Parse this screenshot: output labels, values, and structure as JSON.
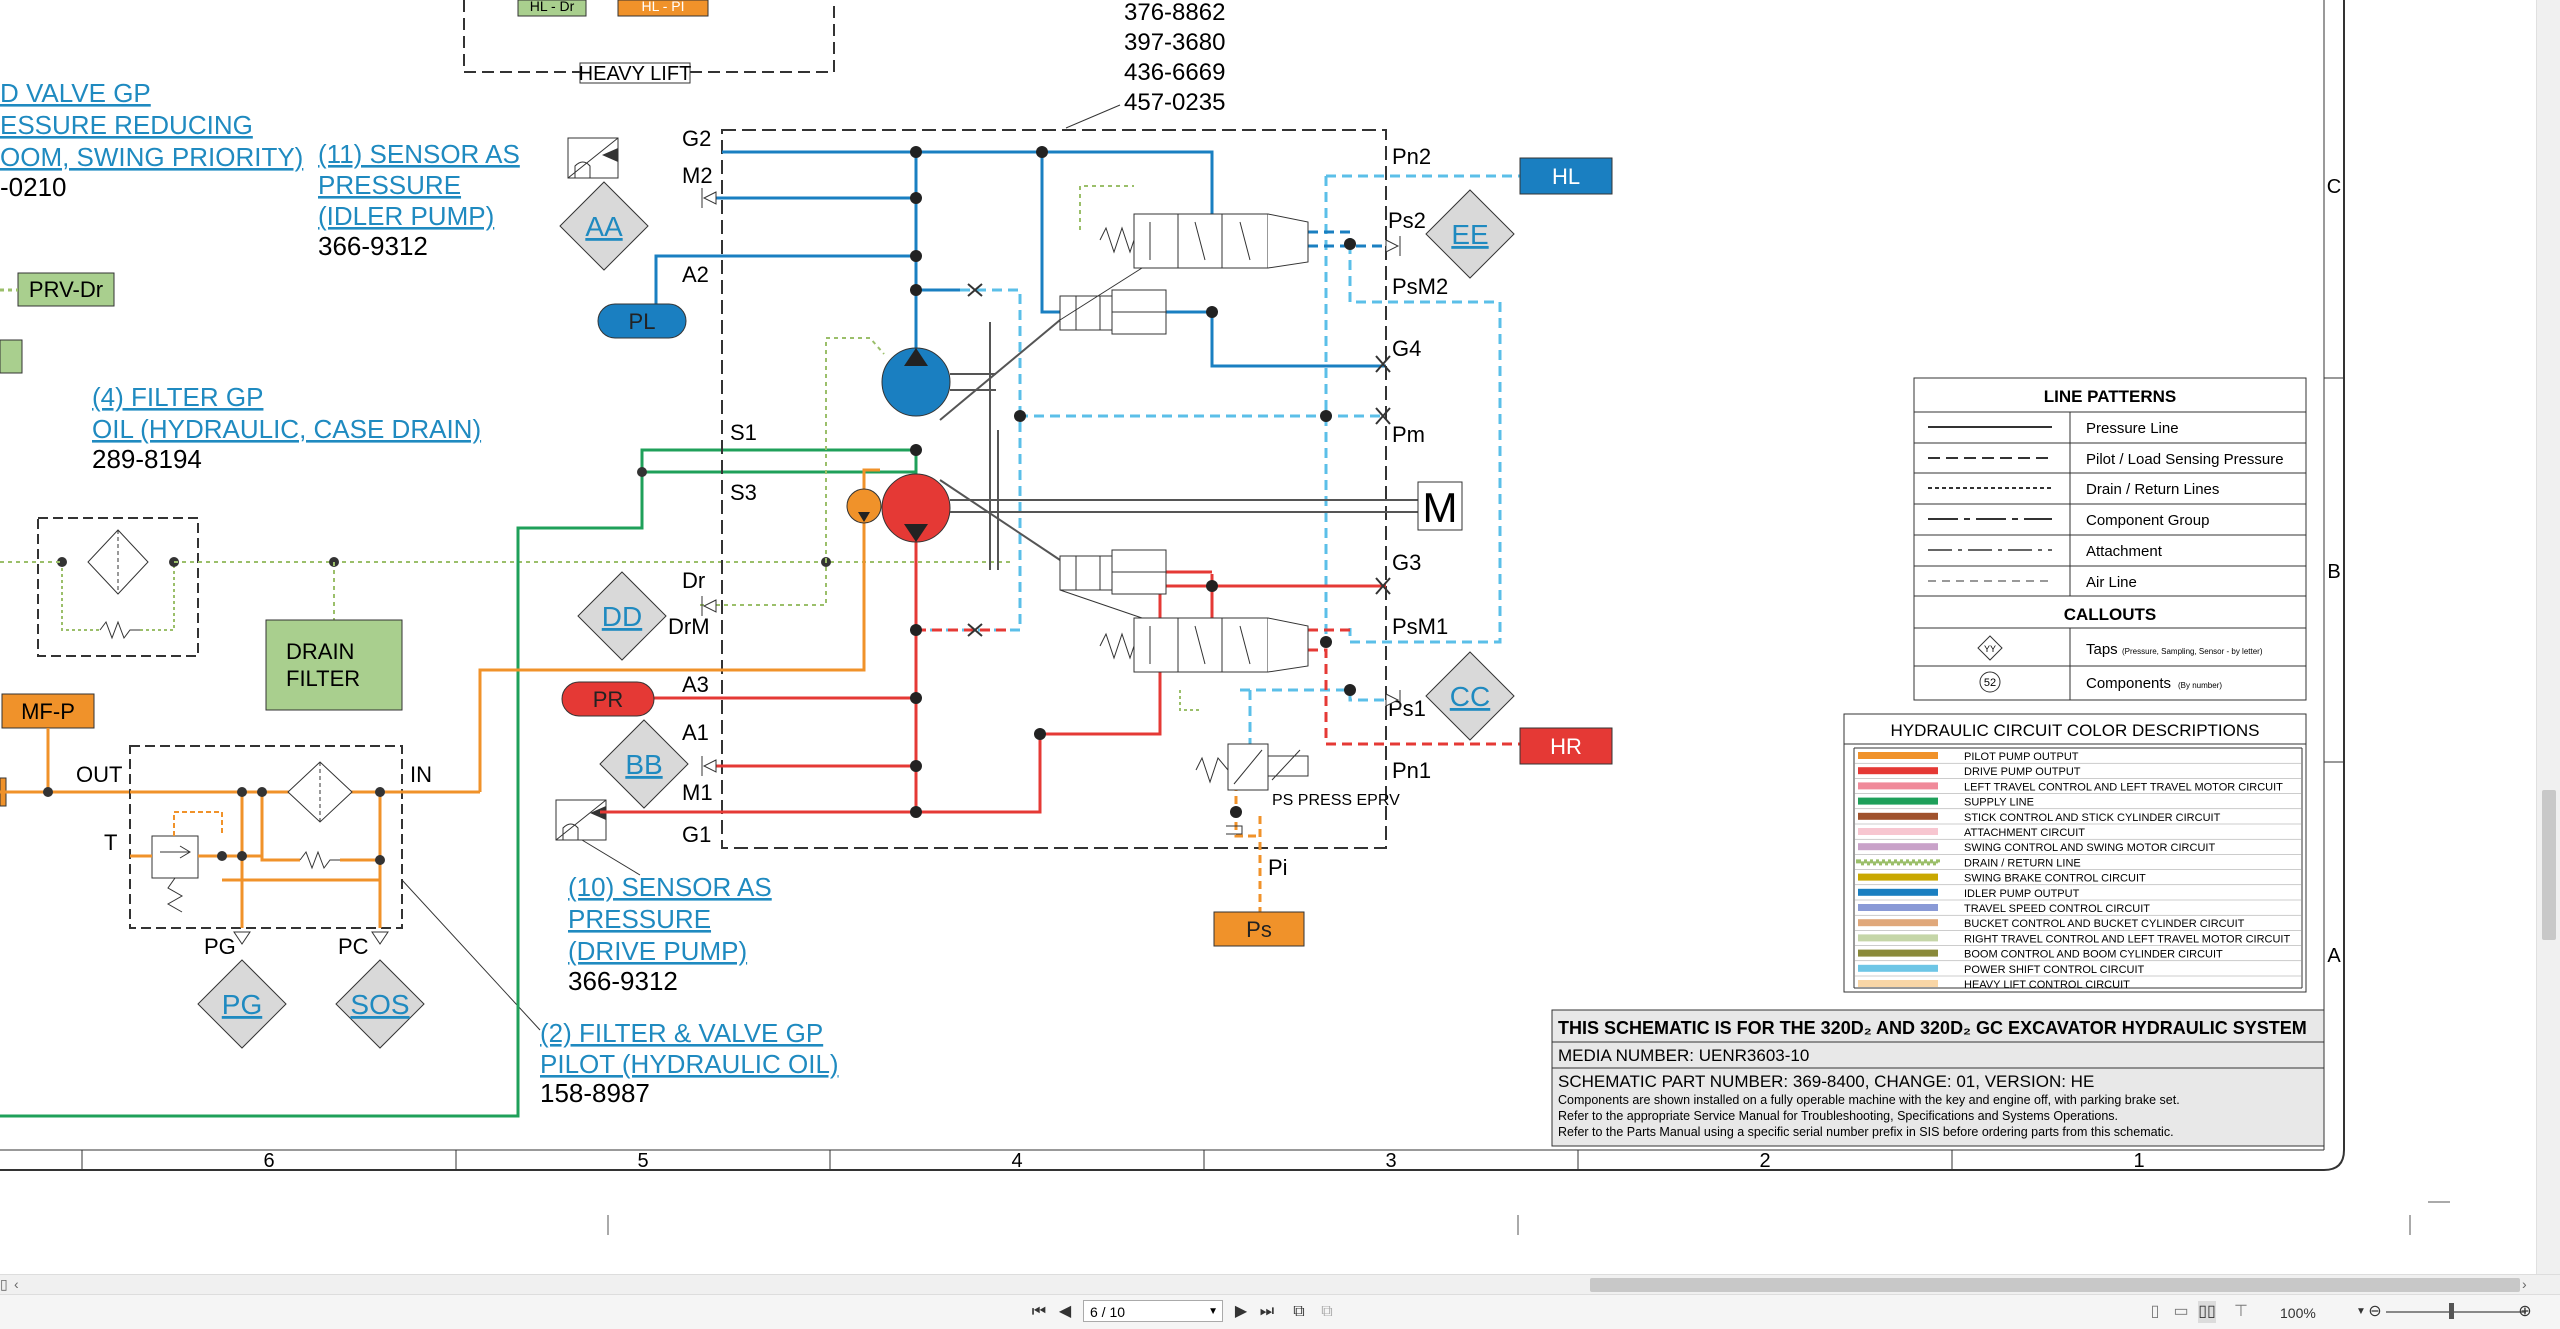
{
  "schematic": {
    "title_block": {
      "heading": "THIS SCHEMATIC IS FOR THE 320D₂ AND 320D₂ GC EXCAVATOR HYDRAULIC SYSTEM",
      "media": "MEDIA NUMBER: UENR3603-10",
      "part": "SCHEMATIC PART NUMBER: 369-8400, CHANGE: 01, VERSION: HE",
      "note1": "Components are shown installed on a fully operable machine with the key and engine off, with parking brake set.",
      "note2": "Refer to the appropriate Service Manual for Troubleshooting, Specifications and Systems Operations.",
      "note3": "Refer to the Parts Manual using a specific serial number prefix in SIS before ordering parts from this schematic."
    },
    "line_patterns": {
      "title": "LINE PATTERNS",
      "items": [
        "Pressure Line",
        "Pilot / Load Sensing Pressure",
        "Drain / Return Lines",
        "Component Group",
        "Attachment",
        "Air Line"
      ],
      "callouts_title": "CALLOUTS",
      "taps_label": "Taps",
      "taps_sub": "(Pressure, Sampling, Sensor - by letter)",
      "taps_symbol": "YY",
      "components_label": "Components",
      "components_sub": "(By number)",
      "components_symbol": "52"
    },
    "color_desc": {
      "title": "HYDRAULIC CIRCUIT COLOR DESCRIPTIONS",
      "items": [
        {
          "label": "PILOT PUMP OUTPUT",
          "color": "#f0922a"
        },
        {
          "label": "DRIVE PUMP OUTPUT",
          "color": "#e53935"
        },
        {
          "label": "LEFT TRAVEL CONTROL AND LEFT TRAVEL MOTOR CIRCUIT",
          "color": "#f08a9a"
        },
        {
          "label": "SUPPLY LINE",
          "color": "#1fa05a"
        },
        {
          "label": "STICK CONTROL AND STICK CYLINDER CIRCUIT",
          "color": "#a0522d"
        },
        {
          "label": "ATTACHMENT CIRCUIT",
          "color": "#f7c6d0"
        },
        {
          "label": "SWING CONTROL AND SWING MOTOR CIRCUIT",
          "color": "#c9a2c9"
        },
        {
          "label": "DRAIN / RETURN LINE",
          "color": "#9bbf6a"
        },
        {
          "label": "SWING BRAKE CONTROL CIRCUIT",
          "color": "#c9a800"
        },
        {
          "label": "IDLER PUMP OUTPUT",
          "color": "#1a7fc1"
        },
        {
          "label": "TRAVEL SPEED CONTROL CIRCUIT",
          "color": "#8a9ad6"
        },
        {
          "label": "BUCKET CONTROL AND BUCKET CYLINDER CIRCUIT",
          "color": "#e0a87a"
        },
        {
          "label": "RIGHT TRAVEL CONTROL AND LEFT TRAVEL MOTOR CIRCUIT",
          "color": "#c5d6a8"
        },
        {
          "label": "BOOM CONTROL AND BOOM CYLINDER CIRCUIT",
          "color": "#8a8a3a"
        },
        {
          "label": "POWER SHIFT CONTROL CIRCUIT",
          "color": "#6ec6e6"
        },
        {
          "label": "HEAVY LIFT CONTROL CIRCUIT",
          "color": "#f9d6a6"
        }
      ]
    },
    "grid": {
      "cols": [
        "6",
        "5",
        "4",
        "3",
        "2",
        "1"
      ],
      "rows": [
        "C",
        "B",
        "A"
      ]
    },
    "labels": {
      "heavy_lift": "HEAVY LIFT",
      "hl_dr": "HL - Dr",
      "hl_pi": "HL - PI",
      "pump_parts": [
        "376-8862",
        "397-3680",
        "436-6669",
        "457-0235"
      ],
      "valve_gp_1": "D VALVE GP",
      "valve_gp_2": "ESSURE REDUCING",
      "valve_gp_3": "OOM, SWING PRIORITY)",
      "valve_gp_4": "-0210",
      "sensor11_1": "(11) SENSOR AS",
      "sensor11_2": "PRESSURE",
      "sensor11_3": "(IDLER PUMP)",
      "sensor11_part": "366-9312",
      "filter4_1": "(4) FILTER GP",
      "filter4_2": "OIL (HYDRAULIC, CASE DRAIN)",
      "filter4_part": "289-8194",
      "sensor10_1": "(10) SENSOR AS",
      "sensor10_2": "PRESSURE",
      "sensor10_3": "(DRIVE PUMP)",
      "sensor10_part": "366-9312",
      "filter2_1": "(2) FILTER & VALVE GP",
      "filter2_2": "PILOT (HYDRAULIC OIL)",
      "filter2_part": "158-8987",
      "drain_filter_1": "DRAIN",
      "drain_filter_2": "FILTER",
      "prv_dr": "PRV-Dr",
      "mf_p": "MF-P",
      "out": "OUT",
      "in": "IN",
      "t": "T",
      "pg_port": "PG",
      "pc_port": "PC",
      "ps_press_eprv": "PS PRESS EPRV",
      "pi": "Pi",
      "m": "M",
      "ports": [
        "G2",
        "M2",
        "A2",
        "S1",
        "S3",
        "Dr",
        "DrM",
        "A3",
        "A1",
        "M1",
        "G1",
        "Pn2",
        "Ps2",
        "PsM2",
        "G4",
        "Pm",
        "G3",
        "PsM1",
        "Ps1",
        "Pn1"
      ]
    },
    "taps": [
      "AA",
      "EE",
      "DD",
      "BB",
      "CC",
      "PG",
      "SOS"
    ],
    "tags": {
      "hl": "HL",
      "hr": "HR",
      "pl": "PL",
      "pr": "PR",
      "ps": "Ps"
    }
  },
  "viewer": {
    "page_indicator": "6 / 10",
    "zoom": "100%",
    "buttons": {
      "first": "first-page",
      "prev": "prev-page",
      "next": "next-page",
      "last": "last-page"
    }
  }
}
